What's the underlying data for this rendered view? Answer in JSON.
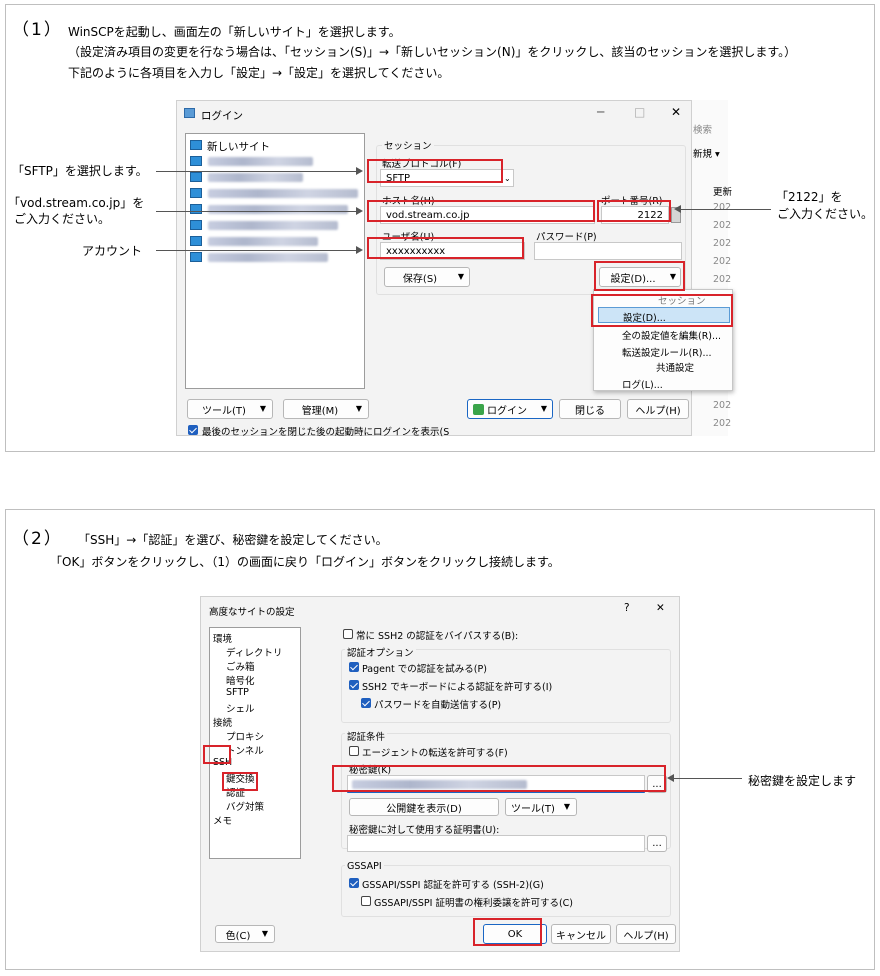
{
  "step1": {
    "number": "（1）",
    "line1": "WinSCPを起動し、画面左の「新しいサイト」を選択します。",
    "line2": "（設定済み項目の変更を行なう場合は、「セッション(S)」→「新しいセッション(N)」をクリックし、該当のセッションを選択します。）",
    "line3": "下記のように各項目を入力し「設定」→「設定」を選択してください。",
    "annotations": {
      "sftp": "「SFTP」を選択します。",
      "host_a": "「vod.stream.co.jp」を",
      "host_b": "ご入力ください。",
      "account": "アカウント",
      "port_a": "「2122」を",
      "port_b": "ご入力ください。"
    },
    "login_window": {
      "title": "ログイン",
      "minimize": "─",
      "maximize": "□",
      "close": "✕",
      "site_new": "新しいサイト",
      "session_group": "セッション",
      "protocol_label": "転送プロトコル(F)",
      "protocol_value": "SFTP",
      "host_label": "ホスト名(H)",
      "host_value": "vod.stream.co.jp",
      "port_label": "ポート番号(R)",
      "port_value": "2122",
      "user_label": "ユーザ名(U)",
      "user_value": "xxxxxxxxxx",
      "password_label": "パスワード(P)",
      "save_button": "保存(S)",
      "settings_button": "設定(D)...",
      "menu_header": "セッション",
      "menu_settings": "設定(D)...",
      "menu_edit_all": "全の設定値を編集(R)...",
      "menu_transfer_rules": "転送設定ルール(R)...",
      "menu_common": "共通設定",
      "menu_log": "ログ(L)...",
      "tools_button": "ツール(T)",
      "manage_button": "管理(M)",
      "login_button": "ログイン",
      "close_button": "閉じる",
      "help_button": "ヘルプ(H)",
      "footer_check": "最後のセッションを閉じた後の起動時にログインを表示(S",
      "bg_search": "検索",
      "bg_new": "新規 ▾",
      "bg_update": "更新",
      "bg_year": "202"
    }
  },
  "step2": {
    "number": "（2）",
    "line1": "「SSH」→「認証」を選び、秘密鍵を設定してください。",
    "line2": "「OK」ボタンをクリックし、（1）の画面に戻り「ログイン」ボタンをクリックし接続します。",
    "annotation_key": "秘密鍵を設定します",
    "dialog": {
      "title": "高度なサイトの設定",
      "help": "?",
      "close": "✕",
      "tree": [
        "環境",
        "ディレクトリ",
        "ごみ箱",
        "暗号化",
        "SFTP",
        "シェル",
        "接続",
        "プロキシ",
        "トンネル",
        "SSH",
        "鍵交換",
        "認証",
        "バグ対策",
        "メモ"
      ],
      "bypass": "常に SSH2 の認証をバイパスする(B):",
      "auth_options": "認証オプション",
      "pageant": "Pagent での認証を試みる(P)",
      "keyboard": "SSH2 でキーボードによる認証を許可する(I)",
      "password_auto": "パスワードを自動送信する(P)",
      "auth_conditions": "認証条件",
      "agent_forward": "エージェントの転送を許可する(F)",
      "private_key": "秘密鍵(K)",
      "browse": "...",
      "show_public": "公開鍵を表示(D)",
      "tools": "ツール(T)",
      "cert_label": "秘密鍵に対して使用する証明書(U):",
      "gssapi": "GSSAPI",
      "gssapi_allow": "GSSAPI/SSPI 認証を許可する (SSH-2)(G)",
      "gssapi_deleg": "GSSAPI/SSPI 証明書の権利委譲を許可する(C)",
      "color": "色(C)",
      "ok": "OK",
      "cancel": "キャンセル",
      "help_button": "ヘルプ(H)"
    }
  }
}
